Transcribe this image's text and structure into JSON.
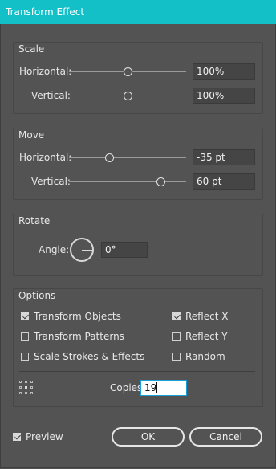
{
  "window": {
    "title": "Transform Effect"
  },
  "scale": {
    "title": "Scale",
    "horizontal": {
      "label": "Horizontal:",
      "value": "100%",
      "slider_fraction": 0.5
    },
    "vertical": {
      "label": "Vertical:",
      "value": "100%",
      "slider_fraction": 0.5
    }
  },
  "move": {
    "title": "Move",
    "horizontal": {
      "label": "Horizontal:",
      "value": "-35 pt",
      "slider_fraction": 0.33
    },
    "vertical": {
      "label": "Vertical:",
      "value": "60 pt",
      "slider_fraction": 0.79
    }
  },
  "rotate": {
    "title": "Rotate",
    "angle_label": "Angle:",
    "angle_value": "0°"
  },
  "options": {
    "title": "Options",
    "checkboxes": [
      {
        "label": "Transform Objects",
        "checked": true
      },
      {
        "label": "Transform Patterns",
        "checked": false
      },
      {
        "label": "Scale Strokes & Effects",
        "checked": false
      },
      {
        "label": "Reflect X",
        "checked": true
      },
      {
        "label": "Reflect Y",
        "checked": false
      },
      {
        "label": "Random",
        "checked": false
      }
    ],
    "copies_label": "Copies",
    "copies_value": "19"
  },
  "footer": {
    "preview_label": "Preview",
    "preview_checked": true,
    "ok_label": "OK",
    "cancel_label": "Cancel"
  },
  "colors": {
    "titlebar": "#13c0c8",
    "panel": "#535353",
    "field": "#454545"
  }
}
